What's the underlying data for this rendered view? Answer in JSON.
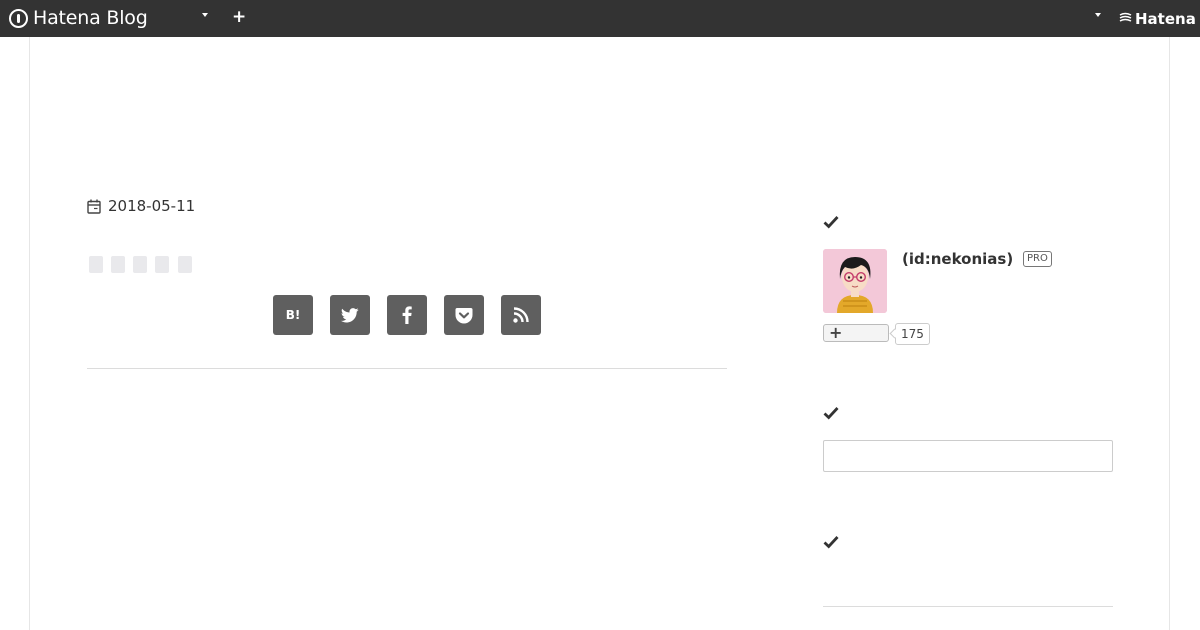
{
  "header": {
    "logo_text": "Hatena Blog",
    "brand_text": "Hatena",
    "background_color": "#333333"
  },
  "entry": {
    "date": "2018-05-11",
    "share_buttons": [
      {
        "name": "hatena-bookmark",
        "label": "B!"
      },
      {
        "name": "twitter",
        "label": ""
      },
      {
        "name": "facebook",
        "label": ""
      },
      {
        "name": "pocket",
        "label": ""
      },
      {
        "name": "rss",
        "label": ""
      }
    ]
  },
  "sidebar": {
    "profile": {
      "user_id": "(id:nekonias)",
      "badge": "PRO",
      "subscriber_count": "175"
    }
  }
}
